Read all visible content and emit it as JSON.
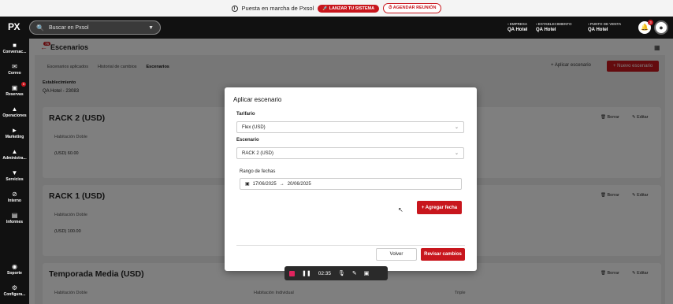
{
  "banner": {
    "message": "Puesta en marcha de Pxsol",
    "launch_label": "LANZAR TU SISTEMA",
    "meeting_label": "AGENDAR REUNIÓN"
  },
  "header": {
    "logo": "PX",
    "search_placeholder": "Buscar en Pxsol",
    "empresa_label": "EMPRESA",
    "empresa_value": "QA Hotel",
    "establecimiento_label": "ESTABLECIMIENTO",
    "establecimiento_value": "QA Hotel",
    "punto_venta_label": "PUNTO DE VENTA",
    "punto_venta_value": "QA Hotel",
    "notif_count": "3"
  },
  "sidebar": {
    "items": [
      {
        "label": "Conversac..."
      },
      {
        "label": "Correo"
      },
      {
        "label": "Reservas",
        "badge": "5"
      },
      {
        "label": "Operaciones"
      },
      {
        "label": "Marketing"
      },
      {
        "label": "Administra..."
      },
      {
        "label": "Servicios"
      },
      {
        "label": "Interno"
      },
      {
        "label": "Informes"
      },
      {
        "label": "Soporte"
      },
      {
        "label": "Configura..."
      }
    ]
  },
  "page": {
    "title": "Escenarios",
    "title_badge": "75",
    "tabs": [
      "Escenarios aplicados",
      "Historial de cambios",
      "Escenarios"
    ],
    "aplicar_label": "Aplicar escenario",
    "nuevo_label": "Nuevo escenario",
    "establecimiento_label": "Establecimiento",
    "establecimiento_value": "QA Hotel - 23083",
    "cards": [
      {
        "title": "RACK 2 (USD)",
        "col1": "Habitación Doble",
        "row1": "(USD) 60.00"
      },
      {
        "title": "RACK 1 (USD)",
        "col1": "Habitación Doble",
        "row1": "(USD) 100.00"
      },
      {
        "title": "Temporada Media (USD)",
        "col1": "Habitación Doble",
        "col2": "Habitación Individual",
        "col3": "Triple"
      }
    ],
    "borrar_label": "Borrar",
    "editar_label": "Editar"
  },
  "modal": {
    "title": "Aplicar escenario",
    "tarifario_label": "Tarifario",
    "tarifario_value": "Flex (USD)",
    "escenario_label": "Escenario",
    "escenario_value": "RACK 2 (USD)",
    "rango_label": "Rango de fechas",
    "date_from": "17/06/2025",
    "date_to": "20/06/2025",
    "agregar_label": "+ Agregar fecha",
    "volver_label": "Volver",
    "revisar_label": "Revisar cambios"
  },
  "recorder": {
    "time": "02:35"
  }
}
